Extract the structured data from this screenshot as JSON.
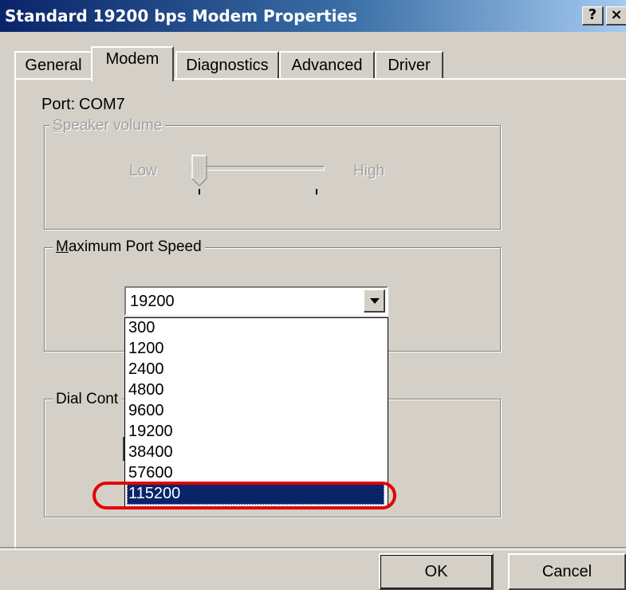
{
  "window": {
    "title": "Standard 19200 bps Modem Properties",
    "help_glyph": "?",
    "close_glyph": "×"
  },
  "tabs": [
    {
      "label": "General",
      "active": false
    },
    {
      "label": "Modem",
      "active": true
    },
    {
      "label": "Diagnostics",
      "active": false
    },
    {
      "label": "Advanced",
      "active": false
    },
    {
      "label": "Driver",
      "active": false
    }
  ],
  "port": {
    "label": "Port:",
    "value": "COM7"
  },
  "speaker_volume": {
    "legend_hotkey": "S",
    "legend_rest": "peaker volume",
    "low_label": "Low",
    "high_label": "High",
    "level": 0.0,
    "enabled": false
  },
  "max_port_speed": {
    "legend_hotkey": "M",
    "legend_rest": "aximum Port Speed",
    "selected_value": "19200",
    "options": [
      "300",
      "1200",
      "2400",
      "4800",
      "9600",
      "19200",
      "38400",
      "57600",
      "115200"
    ],
    "highlighted_option": "115200"
  },
  "dial_control": {
    "legend": "Dial Cont"
  },
  "buttons": {
    "ok": "OK",
    "cancel": "Cancel"
  },
  "colors": {
    "title_bar": "#0a246a",
    "dialog_face": "#d4d0c8",
    "selection": "#0a246a",
    "annotation_ring": "#e30000"
  }
}
